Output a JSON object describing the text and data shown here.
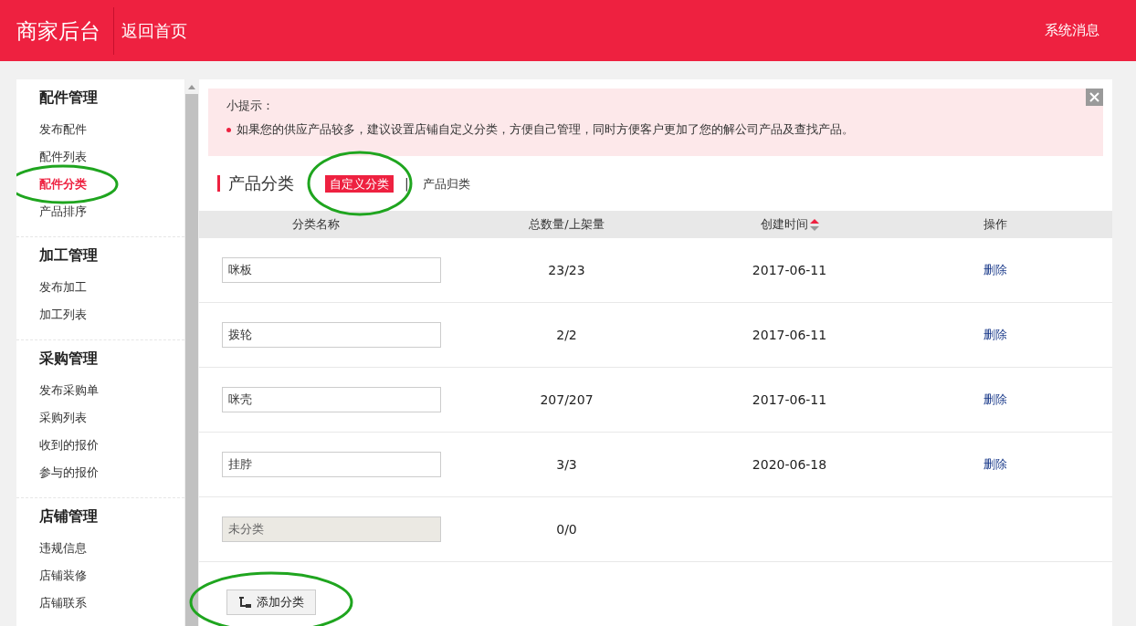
{
  "header": {
    "title": "商家后台",
    "back_link": "返回首页",
    "messages": "系统消息"
  },
  "sidebar": {
    "groups": [
      {
        "title": "配件管理",
        "items": [
          {
            "label": "发布配件",
            "selected": false,
            "circled": false
          },
          {
            "label": "配件列表",
            "selected": false,
            "circled": false
          },
          {
            "label": "配件分类",
            "selected": true,
            "circled": true
          },
          {
            "label": "产品排序",
            "selected": false,
            "circled": false
          }
        ]
      },
      {
        "title": "加工管理",
        "items": [
          {
            "label": "发布加工",
            "selected": false,
            "circled": false
          },
          {
            "label": "加工列表",
            "selected": false,
            "circled": false
          }
        ]
      },
      {
        "title": "采购管理",
        "items": [
          {
            "label": "发布采购单",
            "selected": false,
            "circled": false
          },
          {
            "label": "采购列表",
            "selected": false,
            "circled": false
          },
          {
            "label": "收到的报价",
            "selected": false,
            "circled": false
          },
          {
            "label": "参与的报价",
            "selected": false,
            "circled": false
          }
        ]
      },
      {
        "title": "店铺管理",
        "items": [
          {
            "label": "违规信息",
            "selected": false,
            "circled": false
          },
          {
            "label": "店铺装修",
            "selected": false,
            "circled": false
          },
          {
            "label": "店铺联系",
            "selected": false,
            "circled": false
          }
        ]
      }
    ]
  },
  "notice": {
    "title": "小提示：",
    "items": [
      "如果您的供应产品较多，建议设置店铺自定义分类，方便自己管理，同时方便客户更加了您的解公司产品及查找产品。"
    ]
  },
  "section": {
    "title": "产品分类",
    "separator": "|",
    "tabs": [
      {
        "label": "自定义分类",
        "selected": true,
        "circled": true
      },
      {
        "label": "产品归类",
        "selected": false,
        "circled": false
      }
    ]
  },
  "table": {
    "columns": [
      {
        "label": "分类名称",
        "sortable": false
      },
      {
        "label": "总数量/上架量",
        "sortable": false
      },
      {
        "label": "创建时间",
        "sortable": true
      },
      {
        "label": "操作",
        "sortable": false
      }
    ],
    "rows": [
      {
        "name": "咪板",
        "disabled": false,
        "count": "23/23",
        "date": "2017-06-11",
        "action": "删除"
      },
      {
        "name": "拨轮",
        "disabled": false,
        "count": "2/2",
        "date": "2017-06-11",
        "action": "删除"
      },
      {
        "name": "咪壳",
        "disabled": false,
        "count": "207/207",
        "date": "2017-06-11",
        "action": "删除"
      },
      {
        "name": "挂脖",
        "disabled": false,
        "count": "3/3",
        "date": "2020-06-18",
        "action": "删除"
      },
      {
        "name": "未分类",
        "disabled": true,
        "count": "0/0"
      }
    ]
  },
  "add_button": {
    "label": "添加分类",
    "circled": true
  }
}
